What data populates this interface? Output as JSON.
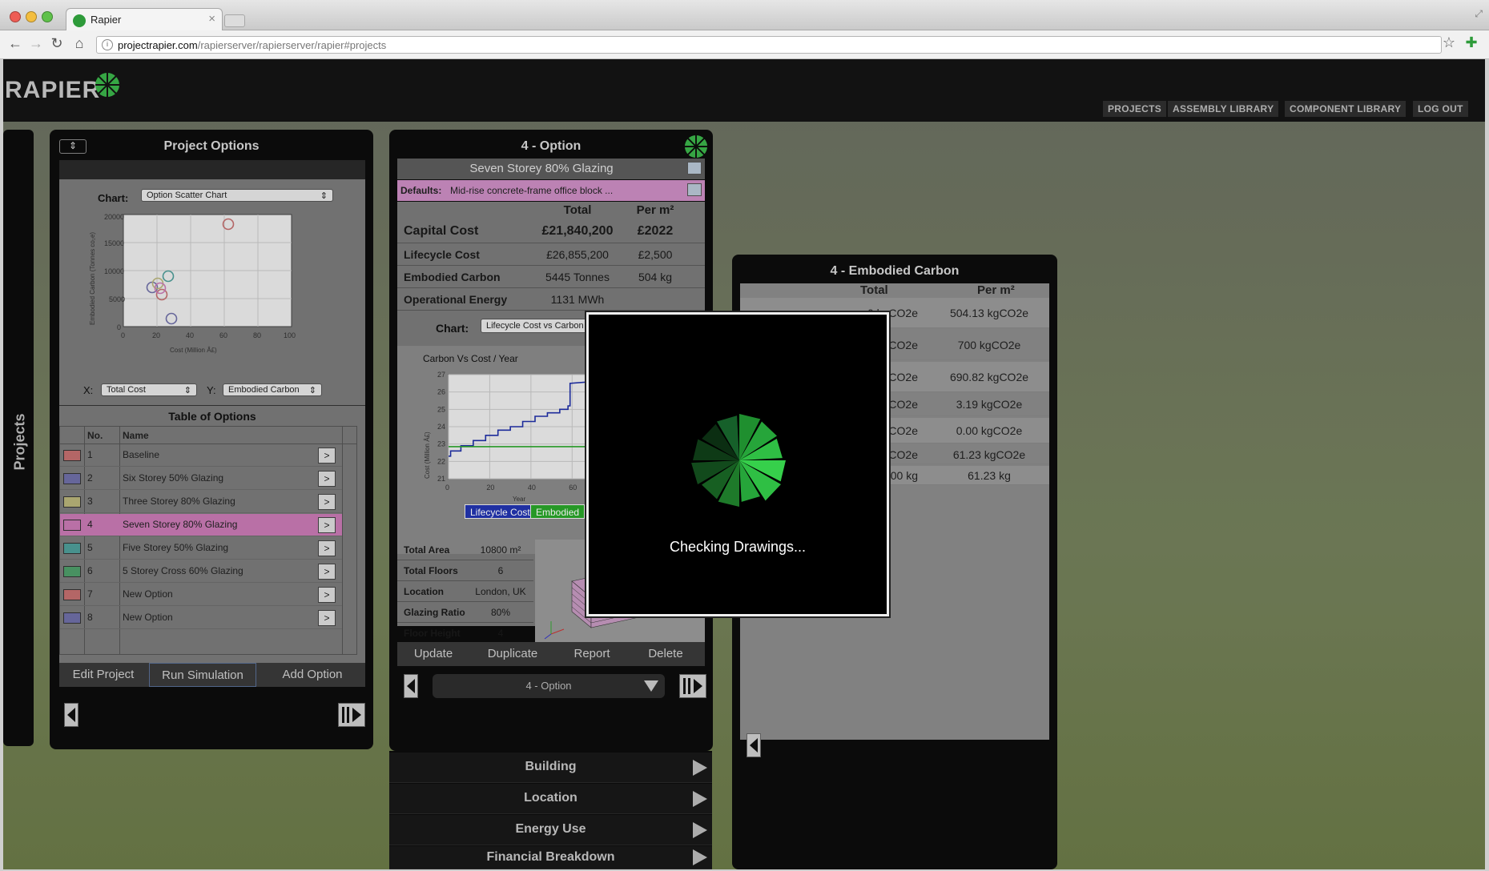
{
  "browser": {
    "tab_title": "Rapier",
    "url_host": "projectrapier.com",
    "url_path": "/rapierserver/rapierserver/rapier#projects"
  },
  "app": {
    "logo": "RAPIER",
    "nav": [
      "PROJECTS",
      "ASSEMBLY LIBRARY",
      "COMPONENT LIBRARY",
      "LOG OUT"
    ],
    "projects_tab": "Projects"
  },
  "project_options": {
    "title": "Project Options",
    "chart_label": "Chart:",
    "chart_select": "Option Scatter Chart",
    "x_label": "X:",
    "x_select": "Total Cost",
    "y_label": "Y:",
    "y_select": "Embodied Carbon",
    "table_title": "Table of Options",
    "col_no": "No.",
    "col_name": "Name",
    "options": [
      {
        "no": "1",
        "name": "Baseline",
        "color": "#c46f6f"
      },
      {
        "no": "2",
        "name": "Six Storey 50% Glazing",
        "color": "#6f6fa8"
      },
      {
        "no": "3",
        "name": "Three Storey 80% Glazing",
        "color": "#b9b57a"
      },
      {
        "no": "4",
        "name": "Seven Storey 80% Glazing",
        "color": "#c97ab5"
      },
      {
        "no": "5",
        "name": "Five Storey 50% Glazing",
        "color": "#4f9e9a"
      },
      {
        "no": "6",
        "name": "5 Storey Cross 60% Glazing",
        "color": "#4f9e6a"
      },
      {
        "no": "7",
        "name": "New Option",
        "color": "#c46f6f"
      },
      {
        "no": "8",
        "name": "New Option",
        "color": "#6f6fa8"
      }
    ],
    "row_button": ">",
    "buttons": [
      "Edit Project",
      "Run Simulation",
      "Add Option"
    ]
  },
  "scatter": {
    "ylabel": "Embodied Carbon (Tonnes co₂e)",
    "xlabel": "Cost (Million Â£)",
    "xticks": [
      "0",
      "20",
      "40",
      "60",
      "80",
      "100"
    ],
    "yticks": [
      "0",
      "5000",
      "10000",
      "15000",
      "20000"
    ]
  },
  "option_panel": {
    "title": "4 - Option",
    "subtitle": "Seven Storey 80% Glazing",
    "defaults_label": "Defaults:",
    "defaults_value": "Mid-rise concrete-frame office block ...",
    "col_total": "Total",
    "col_per": "Per m²",
    "metrics": [
      {
        "label": "Capital Cost",
        "total": "£21,840,200",
        "per": "£2022"
      },
      {
        "label": "Lifecycle Cost",
        "total": "£26,855,200",
        "per": "£2,500"
      },
      {
        "label": "Embodied Carbon",
        "total": "5445 Tonnes",
        "per": "504 kg"
      },
      {
        "label": "Operational Energy",
        "total": "1131 MWh",
        "per": ""
      }
    ],
    "chart_label": "Chart:",
    "chart_select": "Lifecycle Cost vs Carbon",
    "legend": [
      "Lifecycle Cost",
      "Embodied"
    ],
    "info": [
      {
        "k": "Total Area",
        "v": "10800 m²"
      },
      {
        "k": "Total Floors",
        "v": "6"
      },
      {
        "k": "Location",
        "v": "London, UK"
      },
      {
        "k": "Glazing Ratio",
        "v": "80%"
      },
      {
        "k": "Floor Height",
        "v": "4"
      }
    ],
    "buttons": [
      "Update",
      "Duplicate",
      "Report",
      "Delete"
    ],
    "selector": "4 - Option",
    "accordion": [
      "Building",
      "Location",
      "Energy Use",
      "Financial Breakdown"
    ]
  },
  "chart_data": {
    "type": "line",
    "title": "Carbon Vs Cost / Year",
    "xlabel": "Year",
    "ylabel": "Cost (Million Â£)",
    "xlim": [
      0,
      70
    ],
    "ylim": [
      21,
      27
    ],
    "xticks": [
      "0",
      "20",
      "40",
      "60"
    ],
    "yticks": [
      "21",
      "22",
      "23",
      "24",
      "25",
      "26",
      "27"
    ],
    "series": [
      {
        "name": "Lifecycle Cost",
        "color": "#1f2fa8",
        "x": [
          0,
          1,
          1,
          6,
          6,
          12,
          12,
          18,
          18,
          24,
          24,
          30,
          30,
          36,
          36,
          42,
          42,
          48,
          48,
          54,
          54,
          58,
          58,
          59,
          59,
          70
        ],
        "y": [
          22.3,
          22.3,
          22.6,
          22.6,
          22.9,
          22.9,
          23.2,
          23.2,
          23.5,
          23.5,
          23.8,
          23.8,
          24.0,
          24.0,
          24.3,
          24.3,
          24.6,
          24.6,
          24.8,
          24.8,
          25.0,
          25.0,
          25.2,
          25.2,
          26.5,
          26.6
        ]
      },
      {
        "name": "Embodied",
        "color": "#2aa52a",
        "x": [
          0,
          69,
          69,
          70
        ],
        "y": [
          22.85,
          22.85,
          25.0,
          25.0
        ]
      }
    ],
    "legend": "bottom"
  },
  "embodied_panel": {
    "title": "4 - Embodied Carbon",
    "col_total": "Total",
    "col_per": "Per m²",
    "rows": [
      {
        "total": "0 kgCO2e",
        "per": "504.13 kgCO2e"
      },
      {
        "total": "0 kgCO2e",
        "per": "700 kgCO2e"
      },
      {
        "total": "0 kgCO2e",
        "per": "690.82 kgCO2e"
      },
      {
        "total": "kgCO2e",
        "per": "3.19 kgCO2e"
      },
      {
        "total": "CO2e",
        "per": "0.00 kgCO2e"
      },
      {
        "total": "kgCO2e",
        "per": "61.23 kgCO2e"
      },
      {
        "total": "00 kg",
        "per": "61.23 kg"
      }
    ]
  },
  "modal": {
    "message": "Checking Drawings..."
  }
}
